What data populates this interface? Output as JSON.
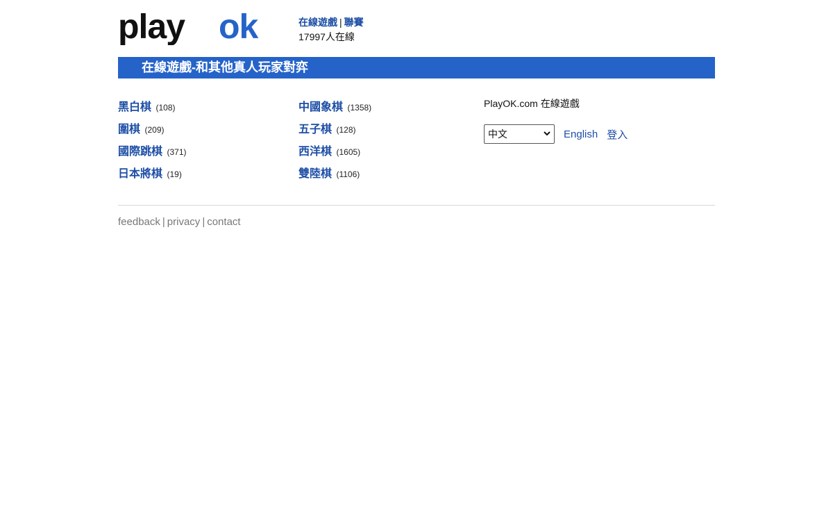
{
  "header": {
    "logo_text": "playok",
    "link_games": "在線遊戲",
    "link_separator": "|",
    "link_tournaments": "聯賽",
    "online_count": "17997人在線"
  },
  "banner": {
    "title": "在線遊戲-和其他真人玩家對弈"
  },
  "games": {
    "col1": [
      {
        "name": "黑白棋",
        "count": "(108)"
      },
      {
        "name": "圍棋",
        "count": "(209)"
      },
      {
        "name": "國際跳棋",
        "count": "(371)"
      },
      {
        "name": "日本將棋",
        "count": "(19)"
      }
    ],
    "col2": [
      {
        "name": "中國象棋",
        "count": "(1358)"
      },
      {
        "name": "五子棋",
        "count": "(128)"
      },
      {
        "name": "西洋棋",
        "count": "(1605)"
      },
      {
        "name": "雙陸棋",
        "count": "(1106)"
      }
    ]
  },
  "side": {
    "title": "PlayOK.com 在線遊戲",
    "language_selected": "中文",
    "english_link": "English",
    "login_link": "登入"
  },
  "footer": {
    "feedback": "feedback",
    "privacy": "privacy",
    "contact": "contact",
    "separator": "|"
  },
  "colors": {
    "accent": "#2563c9",
    "link": "#1d4ea6",
    "logo_dark": "#111111"
  },
  "icons": {
    "select_arrow": "chevron-down-icon"
  }
}
